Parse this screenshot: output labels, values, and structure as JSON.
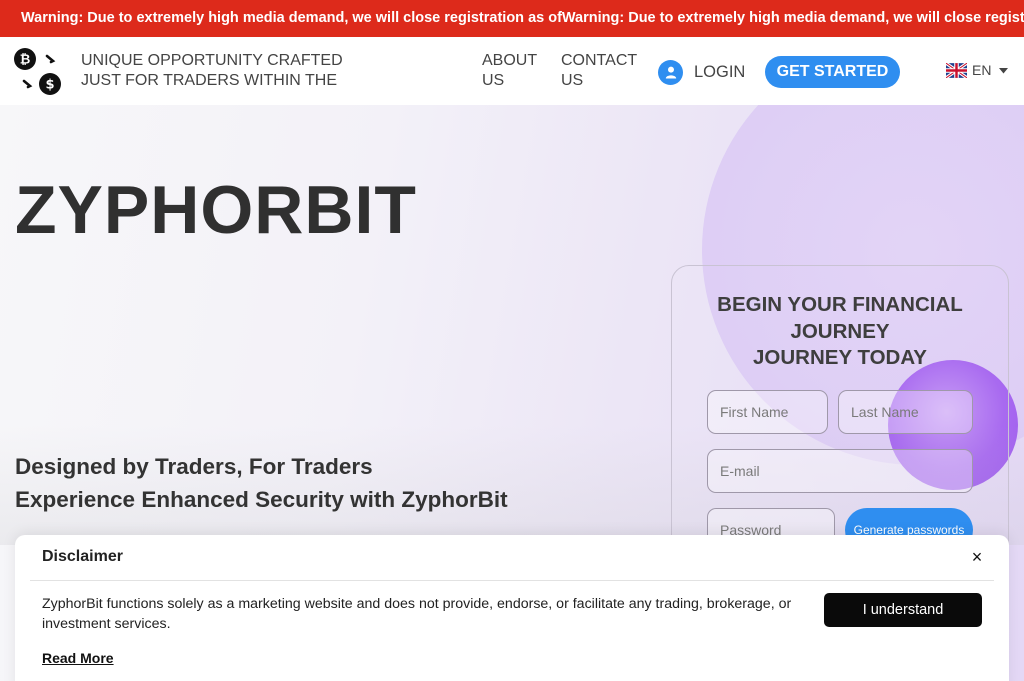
{
  "warning": {
    "text": "Warning: Due to extremely high media demand, we will close registration as ofWarning: Due to extremely high media demand, we will close registration as of"
  },
  "header": {
    "tagline": "UNIQUE OPPORTUNITY CRAFTED JUST FOR TRADERS WITHIN THE",
    "nav": {
      "about": "ABOUT US",
      "contact": "CONTACT US"
    },
    "login_label": "LOGIN",
    "cta_label": "GET STARTED",
    "language": "EN",
    "logo_icon": "bitcoin-dollar-exchange-icon"
  },
  "hero": {
    "brand": "ZYPHORBIT",
    "subtitle_1": "Designed by Traders, For Traders",
    "subtitle_2": "Experience Enhanced Security with ZyphorBit"
  },
  "form": {
    "title_line_1": "BEGIN YOUR FINANCIAL JOURNEY",
    "title_line_2": "JOURNEY TODAY",
    "first_name_placeholder": "First Name",
    "last_name_placeholder": "Last Name",
    "email_placeholder": "E-mail",
    "password_placeholder": "Password",
    "generate_label": "Generate passwords"
  },
  "disclaimer": {
    "title": "Disclaimer",
    "close_glyph": "×",
    "body": "ZyphorBit functions solely as a marketing website and does not provide, endorse, or facilitate any trading, brokerage, or investment services.",
    "read_more": "Read More",
    "accept_label": "I understand"
  },
  "colors": {
    "warning_bg": "#dd2a1b",
    "accent_blue": "#2f8ef0",
    "purple_orb": "#a86af0",
    "dark_button": "#0a0a0a"
  }
}
